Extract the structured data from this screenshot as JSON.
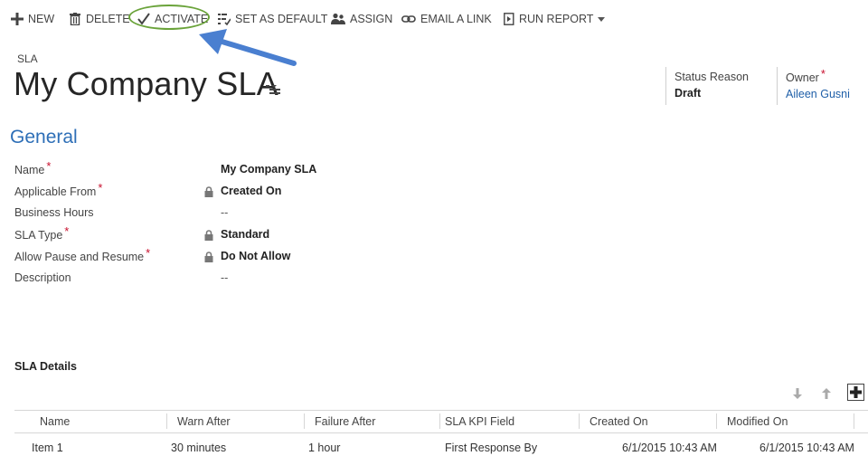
{
  "toolbar": {
    "new": "NEW",
    "delete": "DELETE",
    "activate": "ACTIVATE",
    "set_as_default": "SET AS DEFAULT",
    "assign": "ASSIGN",
    "email_a_link": "EMAIL A LINK",
    "run_report": "RUN REPORT"
  },
  "header": {
    "entity_type": "SLA",
    "title": "My Company SLA",
    "status_reason": {
      "label": "Status Reason",
      "value": "Draft"
    },
    "owner": {
      "label": "Owner",
      "required_mark": "*",
      "value": "Aileen Gusni"
    }
  },
  "general": {
    "title": "General",
    "fields": [
      {
        "label": "Name",
        "required": "*",
        "locked": false,
        "value": "My Company SLA"
      },
      {
        "label": "Applicable From",
        "required": "*",
        "locked": true,
        "value": "Created On"
      },
      {
        "label": "Business Hours",
        "required": "",
        "locked": false,
        "value": "--"
      },
      {
        "label": "SLA Type",
        "required": "*",
        "locked": true,
        "value": "Standard"
      },
      {
        "label": "Allow Pause and Resume",
        "required": "*",
        "locked": true,
        "value": "Do Not Allow"
      },
      {
        "label": "Description",
        "required": "",
        "locked": false,
        "value": "--"
      }
    ]
  },
  "sla_details": {
    "title": "SLA Details",
    "columns": [
      "Name",
      "Warn After",
      "Failure After",
      "SLA KPI Field",
      "Created On",
      "Modified On"
    ],
    "rows": [
      [
        "Item 1",
        "30 minutes",
        "1 hour",
        "First Response By",
        "6/1/2015 10:43 AM",
        "6/1/2015 10:43 AM"
      ]
    ]
  },
  "colors": {
    "accent_blue": "#2e6fb7",
    "link_blue": "#1f5fa8",
    "required_red": "#c8102e",
    "highlight_green": "#6aa33a",
    "arrow_blue": "#4a7fd0"
  },
  "icons": {
    "new": "plus-icon",
    "delete": "trash-icon",
    "activate": "checkmark-icon",
    "set_as_default": "list-check-icon",
    "assign": "people-icon",
    "email_a_link": "link-icon",
    "run_report": "report-icon",
    "locked": "lock-icon"
  }
}
